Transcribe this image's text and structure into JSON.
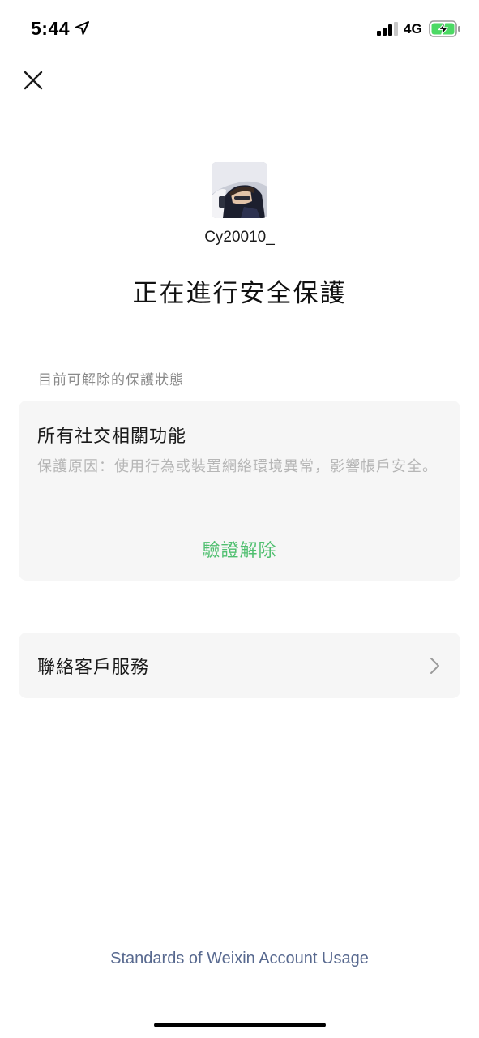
{
  "status_bar": {
    "time": "5:44",
    "network": "4G",
    "icons": [
      "location-arrow-icon",
      "cellular-signal-icon",
      "battery-charging-icon"
    ]
  },
  "header": {
    "close_icon": "close-icon"
  },
  "account": {
    "name": "Cy20010_"
  },
  "page": {
    "title": "正在進行安全保護",
    "section_label": "目前可解除的保護狀態"
  },
  "protection": {
    "title": "所有社交相關功能",
    "reason": "保護原因：使用行為或裝置網絡環境異常，影響帳戶安全。",
    "action_label": "驗證解除"
  },
  "support": {
    "label": "聯絡客戶服務",
    "icon": "chevron-right-icon"
  },
  "footer": {
    "link": "Standards of Weixin Account Usage"
  },
  "colors": {
    "accent_green": "#4fbf6f",
    "link_blue": "#58698f",
    "card_bg": "#f6f6f6",
    "muted_text": "#b6b6b6",
    "battery_green": "#4cd964"
  }
}
